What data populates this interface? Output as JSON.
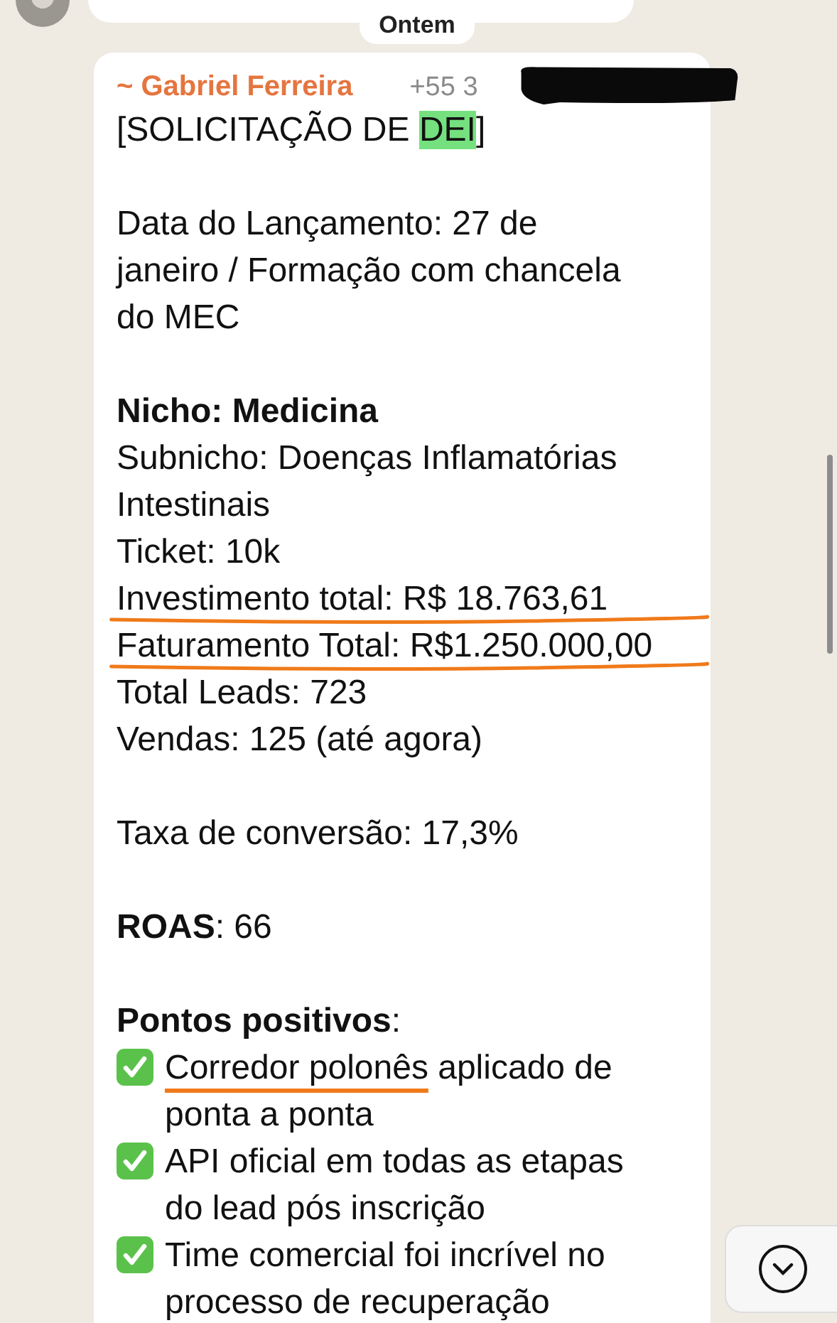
{
  "date_separator": "Ontem",
  "message": {
    "sender": "~ Gabriel Ferreira",
    "phone": "+55 3",
    "phone_redacted": true,
    "title_parts": [
      {
        "text": "[SOLICITAÇÃO DE ",
        "highlighted": false
      },
      {
        "text": "DEI",
        "highlighted": true
      },
      {
        "text": "]",
        "highlighted": false
      }
    ],
    "lines": [
      {
        "kind": "blank"
      },
      {
        "kind": "text",
        "text": "Data do Lançamento: 27 de\njaneiro / Formação com chancela do MEC",
        "underlined": false
      },
      {
        "kind": "blank"
      },
      {
        "kind": "bold",
        "text": "Nicho: Medicina",
        "underlined": false
      },
      {
        "kind": "text",
        "text": "Subnicho: Doenças Inflamatórias Intestinais",
        "underlined": false
      },
      {
        "kind": "text",
        "text": "Ticket: 10k",
        "underlined": false
      },
      {
        "kind": "text",
        "text": "Investimento total: R$ 18.763,61",
        "underlined": true
      },
      {
        "kind": "text",
        "text": "Faturamento Total: R$1.250.000,00",
        "underlined": true
      },
      {
        "kind": "text",
        "text": "Total Leads: 723",
        "underlined": false
      },
      {
        "kind": "text",
        "text": "Vendas: 125 (até agora)",
        "underlined": false
      },
      {
        "kind": "blank"
      },
      {
        "kind": "text",
        "text": "Taxa de conversão: 17,3%",
        "underlined": false
      },
      {
        "kind": "blank"
      },
      {
        "kind": "text",
        "text": "**ROAS**: 66",
        "underlined": false
      },
      {
        "kind": "blank"
      },
      {
        "kind": "text",
        "text": "**Pontos positivos**:",
        "underlined": false
      },
      {
        "kind": "check",
        "parts": [
          {
            "text": "Corredor polonês",
            "underlined": true
          },
          {
            "text": " aplicado de ponta a ponta",
            "underlined": false
          }
        ]
      },
      {
        "kind": "check",
        "parts": [
          {
            "text": "API oficial em todas as etapas do lead pós inscrição",
            "underlined": false
          }
        ]
      },
      {
        "kind": "check",
        "parts": [
          {
            "text": "Time comercial foi incrível no processo de recuperação",
            "underlined": false
          }
        ]
      }
    ]
  }
}
